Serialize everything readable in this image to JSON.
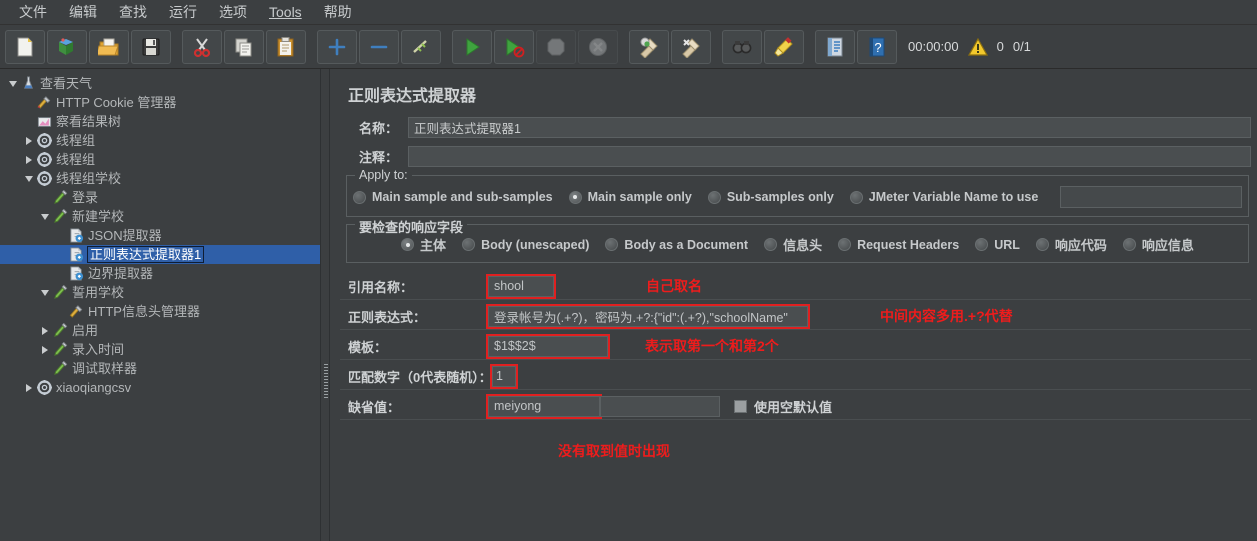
{
  "menu": {
    "items": [
      {
        "label": "文件",
        "mnemonic": ""
      },
      {
        "label": "编辑",
        "mnemonic": ""
      },
      {
        "label": "查找",
        "mnemonic": ""
      },
      {
        "label": "运行",
        "mnemonic": ""
      },
      {
        "label": "选项",
        "mnemonic": ""
      },
      {
        "label": "Tools",
        "mnemonic": "T"
      },
      {
        "label": "帮助",
        "mnemonic": ""
      }
    ]
  },
  "toolbar": {
    "buttons": [
      {
        "name": "new-icon",
        "title": "新建"
      },
      {
        "name": "templates-icon",
        "title": "模板"
      },
      {
        "name": "open-icon",
        "title": "打开"
      },
      {
        "name": "save-icon",
        "title": "保存"
      },
      {
        "name": "cut-icon",
        "title": "剪切"
      },
      {
        "name": "copy-icon",
        "title": "复制"
      },
      {
        "name": "paste-icon",
        "title": "粘贴"
      },
      {
        "name": "expand-icon",
        "title": "展开"
      },
      {
        "name": "collapse-icon",
        "title": "折叠"
      },
      {
        "name": "toggle-icon",
        "title": "启用/禁用"
      },
      {
        "name": "start-icon",
        "title": "启动"
      },
      {
        "name": "start-no-pause-icon",
        "title": "无间隔启动"
      },
      {
        "name": "stop-icon",
        "title": "停止"
      },
      {
        "name": "shutdown-icon",
        "title": "关闭"
      },
      {
        "name": "clear-icon",
        "title": "清除"
      },
      {
        "name": "clear-all-icon",
        "title": "清除全部"
      },
      {
        "name": "search-icon",
        "title": "查找"
      },
      {
        "name": "reset-search-icon",
        "title": "重置查找"
      },
      {
        "name": "function-helper-icon",
        "title": "函数助手"
      },
      {
        "name": "help-icon",
        "title": "帮助"
      }
    ],
    "timer": "00:00:00",
    "warning_count": "0",
    "thread_count": "0/1"
  },
  "tree": {
    "nodes": [
      {
        "indent": 0,
        "toggle": "down",
        "icon": "test-plan-icon",
        "label": "查看天气",
        "selected": false
      },
      {
        "indent": 1,
        "toggle": "none",
        "icon": "cookie-manager-icon",
        "label": "HTTP Cookie 管理器",
        "selected": false
      },
      {
        "indent": 1,
        "toggle": "none",
        "icon": "view-results-icon",
        "label": "察看结果树",
        "selected": false
      },
      {
        "indent": 1,
        "toggle": "right",
        "icon": "thread-group-icon",
        "label": "线程组",
        "selected": false
      },
      {
        "indent": 1,
        "toggle": "right",
        "icon": "thread-group-icon",
        "label": "线程组",
        "selected": false
      },
      {
        "indent": 1,
        "toggle": "down",
        "icon": "thread-group-icon",
        "label": "线程组学校",
        "selected": false
      },
      {
        "indent": 2,
        "toggle": "none",
        "icon": "sampler-icon",
        "label": "登录",
        "selected": false
      },
      {
        "indent": 2,
        "toggle": "down",
        "icon": "sampler-icon",
        "label": "新建学校",
        "selected": false
      },
      {
        "indent": 3,
        "toggle": "none",
        "icon": "extractor-icon",
        "label": "JSON提取器",
        "selected": false
      },
      {
        "indent": 3,
        "toggle": "none",
        "icon": "extractor-icon",
        "label": "正则表达式提取器1",
        "selected": true
      },
      {
        "indent": 3,
        "toggle": "none",
        "icon": "extractor-icon",
        "label": "边界提取器",
        "selected": false
      },
      {
        "indent": 2,
        "toggle": "down",
        "icon": "sampler-icon",
        "label": "誓用学校",
        "selected": false
      },
      {
        "indent": 3,
        "toggle": "none",
        "icon": "header-manager-icon",
        "label": "HTTP信息头管理器",
        "selected": false
      },
      {
        "indent": 2,
        "toggle": "right",
        "icon": "sampler-icon",
        "label": "启用",
        "selected": false
      },
      {
        "indent": 2,
        "toggle": "right",
        "icon": "sampler-icon",
        "label": "录入时间",
        "selected": false
      },
      {
        "indent": 2,
        "toggle": "none",
        "icon": "sampler-icon",
        "label": "调试取样器",
        "selected": false
      },
      {
        "indent": 1,
        "toggle": "right",
        "icon": "thread-group-icon",
        "label": "xiaoqiangcsv",
        "selected": false
      }
    ]
  },
  "panel": {
    "title": "正则表达式提取器",
    "name_label": "名称：",
    "name_value": "正则表达式提取器1",
    "comment_label": "注释：",
    "comment_value": "",
    "apply_to": {
      "title": "Apply to:",
      "options": [
        {
          "label": "Main sample and sub-samples",
          "selected": false
        },
        {
          "label": "Main sample only",
          "selected": true
        },
        {
          "label": "Sub-samples only",
          "selected": false
        },
        {
          "label": "JMeter Variable Name to use",
          "selected": false
        }
      ],
      "variable_value": ""
    },
    "response_field": {
      "title": "要检查的响应字段",
      "options": [
        {
          "label": "主体",
          "selected": true
        },
        {
          "label": "Body (unescaped)",
          "selected": false
        },
        {
          "label": "Body as a Document",
          "selected": false
        },
        {
          "label": "信息头",
          "selected": false
        },
        {
          "label": "Request Headers",
          "selected": false
        },
        {
          "label": "URL",
          "selected": false
        },
        {
          "label": "响应代码",
          "selected": false
        },
        {
          "label": "响应信息",
          "selected": false
        }
      ]
    },
    "fields": {
      "refname_label": "引用名称：",
      "refname_value": "shool",
      "regex_label": "正则表达式：",
      "regex_value": "登录帐号为(.+?)，密码为.+?:{\"id\":(.+?),\"schoolName\"",
      "template_label": "模板：",
      "template_value": "$1$$2$",
      "matchno_label": "匹配数字（0代表随机）：",
      "matchno_value": "1",
      "default_label": "缺省值：",
      "default_value": "meiyong",
      "use_empty_default_label": "使用空默认值",
      "use_empty_default_checked": false
    },
    "annotations": {
      "refname_note": "自己取名",
      "regex_note": "中间内容多用.+?代替",
      "template_note": "表示取第一个和第2个",
      "default_note": "没有取到值时出现"
    }
  },
  "colors": {
    "background": "#3c3f41",
    "selection": "#2f5fa8",
    "annotation": "#ee1c1c",
    "text": "#c8cbcd"
  }
}
